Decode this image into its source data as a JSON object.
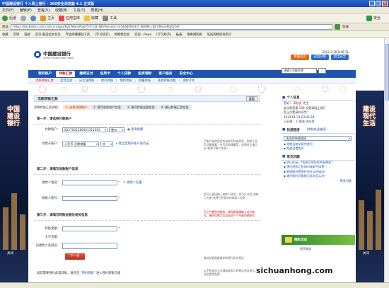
{
  "window": {
    "title": "中国建设银行 个人网上银行 - 360安全浏览器 4.1 正式版"
  },
  "menubar": [
    "文件(F)",
    "编辑(E)",
    "查看(V)",
    "收藏(B)",
    "工具(T)",
    "帮助(H)"
  ],
  "toolbar": {
    "back": "后退",
    "home": "主页",
    "apps": "应用宝库",
    "favorites": "收藏",
    "tools": "工具",
    "safe_label": "安全"
  },
  "address_bar": {
    "url": "https://ibsbjstar.ccb.com.cn/app/B2CMainPlatV5?CCB_IBSVersion=V5&SERVLET_NAME=B2CMainPlatV5#",
    "go_label": "加速"
  },
  "favorites_bar": [
    "收藏",
    "常用",
    "链接",
    "首页-最美拉女包包",
    "专业网赚辅助工具",
    "[学习经济]",
    "购物特卖会",
    "欢迎 - Powe",
    "[学习经济]",
    "拓拓",
    "唯唯网购购",
    "旺旺购物的商宝贝"
  ],
  "bank": {
    "name_cn": "中国建设银行",
    "name_en": "China Construction Bank",
    "date": "2012-3-28 8:46:11",
    "header_buttons": [
      "客服首页",
      "返回旧版",
      "退出安全"
    ],
    "search_placeholder": "请输入功能名称"
  },
  "nav": {
    "tabs": [
      "我的账户",
      "转账汇款",
      "缴费支付",
      "信用卡",
      "个人贷款",
      "投资理财",
      "客户服务",
      "安全中心"
    ],
    "active": "转账汇款"
  },
  "subnav": [
    "活期转账汇款",
    "定活互转",
    "向企业转账",
    "跨行转账",
    "预约转账",
    "批量转账",
    "其他转账功能",
    "功能介绍"
  ],
  "side": {
    "left_text": "中国建设银行",
    "right_text": "建设现代生活",
    "close_label": "关闭"
  },
  "main": {
    "panel_title": "活期转账汇款",
    "back_button": "返回",
    "flow_label": "活期转账汇款流程：",
    "steps": [
      "1. 选择付款账户",
      "2. 填写收款账户信息",
      "3. 填写转账金额信息",
      "4. 确认转账汇款信息"
    ],
    "section1": {
      "title": "第一步：请选择付款账户",
      "payer_label": "付款账户：",
      "payer_value": "6227001580501311692",
      "payer_type": "整存",
      "balance_link": "查询余额",
      "subaccount_label": "付款子账户：",
      "subaccount_value": "人民币 活期储蓄",
      "subaccount_ccy": "钞",
      "subaccount_link": "转出定期子账户请点击",
      "hint": "子账户指的是您的存款币种或类型，例如人民币活期储蓄，外币活期储蓄等。选择好后请点击\"收款子账户信息\"。"
    },
    "section2": {
      "title": "第二步：请填写收款账户信息",
      "payee_name_label": "收款人姓名：",
      "payee_name_link": "收款人名册",
      "payee_account_label": "收款人账号：",
      "hint1": "您可以直接输入收款人姓名，也可以点击\"收款人名册\"选择已经保存的收款人信息",
      "hint2": "为了方便您对转账，请完整准确输入对方账号，每四位数字后自动加一个空格的转账号"
    },
    "section3": {
      "title": "第三步：请填写转账金额及相关信息",
      "amount_label": "转账金额：",
      "amount_upper_label": "大写金额：",
      "notify_label": "向收款人发短信：",
      "hint1": "具体交易限额请参考银行有关规定",
      "hint2": "以手机短信方式通知收款人转账信息及留言，短信费用免费"
    },
    "next_button": "下一步",
    "footnote_prefix": "如您需要预约此笔转账，请点击",
    "footnote_link": "\"预约转账\"",
    "footnote_suffix": "进入预约转账页面"
  },
  "right": {
    "info_title": "个人信息",
    "welcome_label": "您好！",
    "user_name": "高桂良",
    "greeting_suffix": "先生",
    "login_count_text": "此次是您第 136 次登录网上银行",
    "last_login_text": "您上次登录时间为：",
    "last_login_time": "2012/01/31 03:43:24",
    "key_label": "已开通：",
    "key_link": "E 路通 未办理",
    "quick_title": "快速链接",
    "quick_custom": "[定制快速链接]",
    "quick_select": "请选择快速链接",
    "quick_links": [
      "定制当前交易为首页",
      "频道设置首页"
    ],
    "faq_title": "常见问题",
    "faq_items": [
      "Windows 7系统可用的软件有哪些？",
      "银行转账汇款如何收取手续费？",
      "新版国外费率时间什么时候出？",
      "通付款时可能提示乱码怎么办？"
    ],
    "more_link": "更多问题",
    "banner_text": "精彩活动",
    "banner_sub": "网页服务"
  },
  "watermark": "sichuanhong.com"
}
